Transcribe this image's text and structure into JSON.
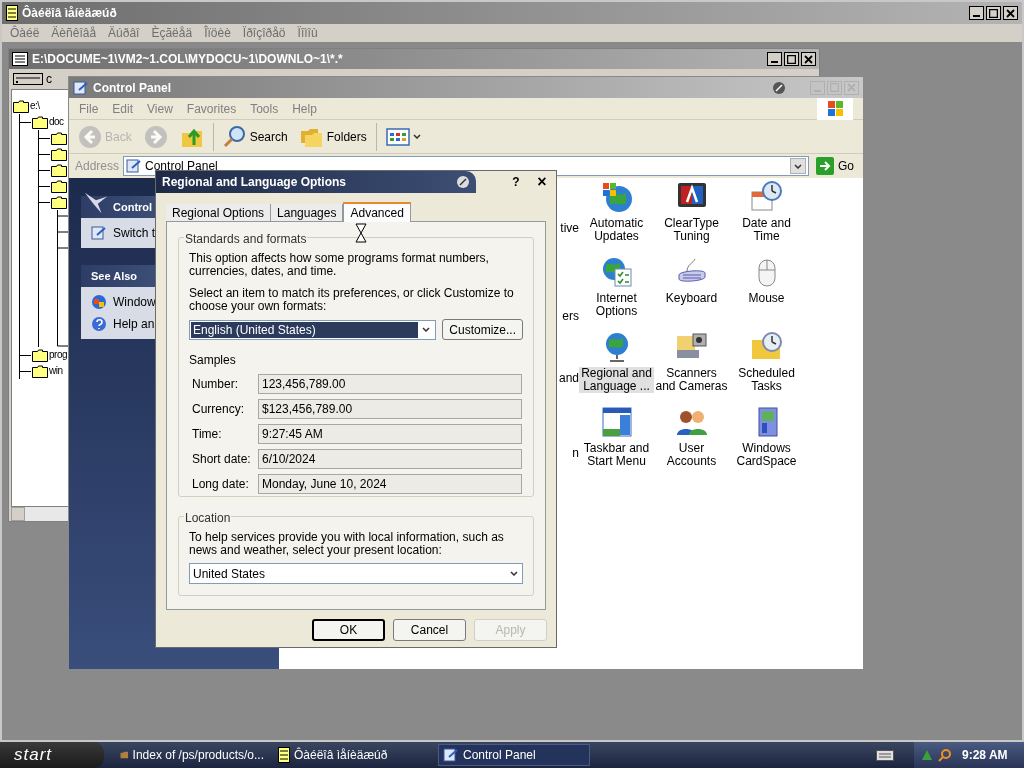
{
  "file_manager": {
    "title": "Ôàéëîâ ìåíèäæúð",
    "menu": [
      {
        "label": "Ôàéë",
        "disabled": true
      },
      {
        "label": "Äèñêîâå",
        "disabled": true
      },
      {
        "label": "Äúðâî",
        "disabled": true
      },
      {
        "label": "Èçãëåä",
        "disabled": true
      },
      {
        "label": "Îïöèè",
        "disabled": true
      },
      {
        "label": "Ïðîçîðåö",
        "disabled": true
      },
      {
        "label": "Ïîìîù",
        "disabled": true
      }
    ]
  },
  "child_window": {
    "title": "E:\\DOCUME~1\\VM2~1.COL\\MYDOCU~1\\DOWNLO~1\\*.*",
    "drive": "c",
    "tree": [
      {
        "kind": "folder",
        "label": "e:\\",
        "children": [
          {
            "kind": "folder",
            "label": "doc",
            "children": [
              {
                "kind": "folder",
                "expanded": false
              },
              {
                "kind": "folder",
                "expanded": false
              },
              {
                "kind": "folder",
                "expanded": false
              },
              {
                "kind": "folder",
                "expanded": false
              },
              {
                "kind": "folder",
                "expanded": true
              }
            ]
          },
          {
            "kind": "folder",
            "label": "prog"
          },
          {
            "kind": "folder",
            "label": "win"
          }
        ]
      }
    ]
  },
  "control_panel": {
    "title": "Control Panel",
    "menu": [
      {
        "label": "File",
        "disabled": true
      },
      {
        "label": "Edit",
        "disabled": true
      },
      {
        "label": "View",
        "disabled": true
      },
      {
        "label": "Favorites",
        "disabled": true
      },
      {
        "label": "Tools",
        "disabled": true
      },
      {
        "label": "Help",
        "disabled": true
      }
    ],
    "toolbar": [
      {
        "kind": "back",
        "label": "Back",
        "disabled": true
      },
      {
        "kind": "forward",
        "disabled": true
      },
      {
        "kind": "up",
        "disabled": false
      },
      {
        "kind": "search",
        "label": "Search",
        "disabled": false
      },
      {
        "kind": "folders",
        "label": "Folders",
        "disabled": false
      },
      {
        "kind": "views",
        "disabled": false
      }
    ],
    "address": {
      "label": "Address",
      "value": "Control Panel",
      "go": "Go"
    },
    "side_panels": [
      {
        "title": "Control",
        "items": [
          {
            "kind": "switch",
            "label": "Switch t"
          }
        ]
      },
      {
        "title": "See Also",
        "items": [
          {
            "kind": "windows",
            "label": "Window"
          },
          {
            "kind": "help",
            "label": "Help an"
          }
        ]
      }
    ],
    "partial_column": [
      "tive",
      "ers",
      "and",
      "n"
    ],
    "items": [
      {
        "kind": "updates",
        "label": "Automatic Updates",
        "selected": false
      },
      {
        "kind": "cleartype",
        "label": "ClearType Tuning",
        "selected": false
      },
      {
        "kind": "datetime",
        "label": "Date and Time",
        "selected": false
      },
      {
        "kind": "internet",
        "label": "Internet Options",
        "selected": false
      },
      {
        "kind": "keyboard",
        "label": "Keyboard",
        "selected": false
      },
      {
        "kind": "mouse",
        "label": "Mouse",
        "selected": false
      },
      {
        "kind": "regional",
        "label": "Regional and Language ...",
        "selected": true
      },
      {
        "kind": "scanners",
        "label": "Scanners and Cameras",
        "selected": false
      },
      {
        "kind": "tasks",
        "label": "Scheduled Tasks",
        "selected": false
      },
      {
        "kind": "taskbar",
        "label": "Taskbar and Start Menu",
        "selected": false
      },
      {
        "kind": "users",
        "label": "User Accounts",
        "selected": false
      },
      {
        "kind": "cardspace",
        "label": "Windows CardSpace",
        "selected": false
      }
    ]
  },
  "dialog": {
    "title": "Regional and Language Options",
    "help": "?",
    "close": "×",
    "tabs": [
      {
        "label": "Regional Options",
        "selected": false
      },
      {
        "label": "Languages",
        "selected": false
      },
      {
        "label": "Advanced",
        "selected": true
      }
    ],
    "standards": {
      "legend": "Standards and formats",
      "intro": "This option affects how some programs format numbers, currencies, dates, and time.",
      "prompt": "Select an item to match its preferences, or click Customize to choose your own formats:",
      "format": "English (United States)",
      "customize": "Customize...",
      "samples_label": "Samples",
      "samples": [
        {
          "label": "Number:",
          "value": "123,456,789.00"
        },
        {
          "label": "Currency:",
          "value": "$123,456,789.00"
        },
        {
          "label": "Time:",
          "value": "9:27:45 AM"
        },
        {
          "label": "Short date:",
          "value": "6/10/2024"
        },
        {
          "label": "Long date:",
          "value": "Monday, June 10, 2024"
        }
      ]
    },
    "location": {
      "legend": "Location",
      "prompt": "To help services provide you with local information, such as news and weather, select your present location:",
      "value": "United States"
    },
    "buttons": [
      {
        "label": "OK",
        "default": true,
        "disabled": false
      },
      {
        "label": "Cancel",
        "default": false,
        "disabled": false
      },
      {
        "label": "Apply",
        "default": false,
        "disabled": true
      }
    ]
  },
  "taskbar": {
    "start": "start",
    "tasks": [
      {
        "kind": "web",
        "label": "Index of /ps/products/o...",
        "selected": false
      },
      {
        "kind": "filemanager",
        "label": "Ôàéëîâ ìåíèäæúð",
        "selected": false
      },
      {
        "kind": "controlpanel",
        "label": "Control Panel",
        "selected": true
      }
    ],
    "clock": "9:28 AM"
  }
}
